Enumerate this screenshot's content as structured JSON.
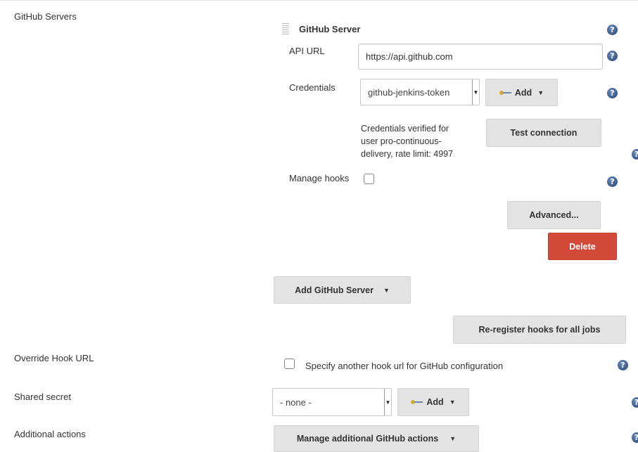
{
  "sections": {
    "github_servers": "GitHub Servers",
    "override_hook_url": "Override Hook URL",
    "shared_secret": "Shared secret",
    "additional_actions": "Additional actions"
  },
  "server": {
    "title": "GitHub Server",
    "api_url_label": "API URL",
    "api_url_value": "https://api.github.com",
    "credentials_label": "Credentials",
    "credentials_selected": "github-jenkins-token",
    "add_label": "Add",
    "credentials_status": [
      "Credentials verified for",
      "user pro-continuous-",
      "delivery, rate limit: 4997"
    ],
    "test_connection_label": "Test connection",
    "manage_hooks_label": "Manage hooks",
    "manage_hooks_checked": false,
    "advanced_label": "Advanced...",
    "delete_label": "Delete"
  },
  "add_server_label": "Add GitHub Server",
  "reregister_label": "Re-register hooks for all jobs",
  "override_hook": {
    "checked": false,
    "label": "Specify another hook url for GitHub configuration"
  },
  "shared_secret": {
    "selected": "- none -",
    "add_label": "Add"
  },
  "additional_actions_label": "Manage additional GitHub actions",
  "icons": {
    "help": "question-mark-icon",
    "key": "key-icon",
    "caret": "caret-down-icon",
    "drag": "drag-handle-icon"
  },
  "help_glyph": "?",
  "caret_glyph": "▼",
  "colors": {
    "button_bg": "#e3e3e3",
    "delete_bg": "#d24939",
    "help_icon": "#1f4378"
  }
}
